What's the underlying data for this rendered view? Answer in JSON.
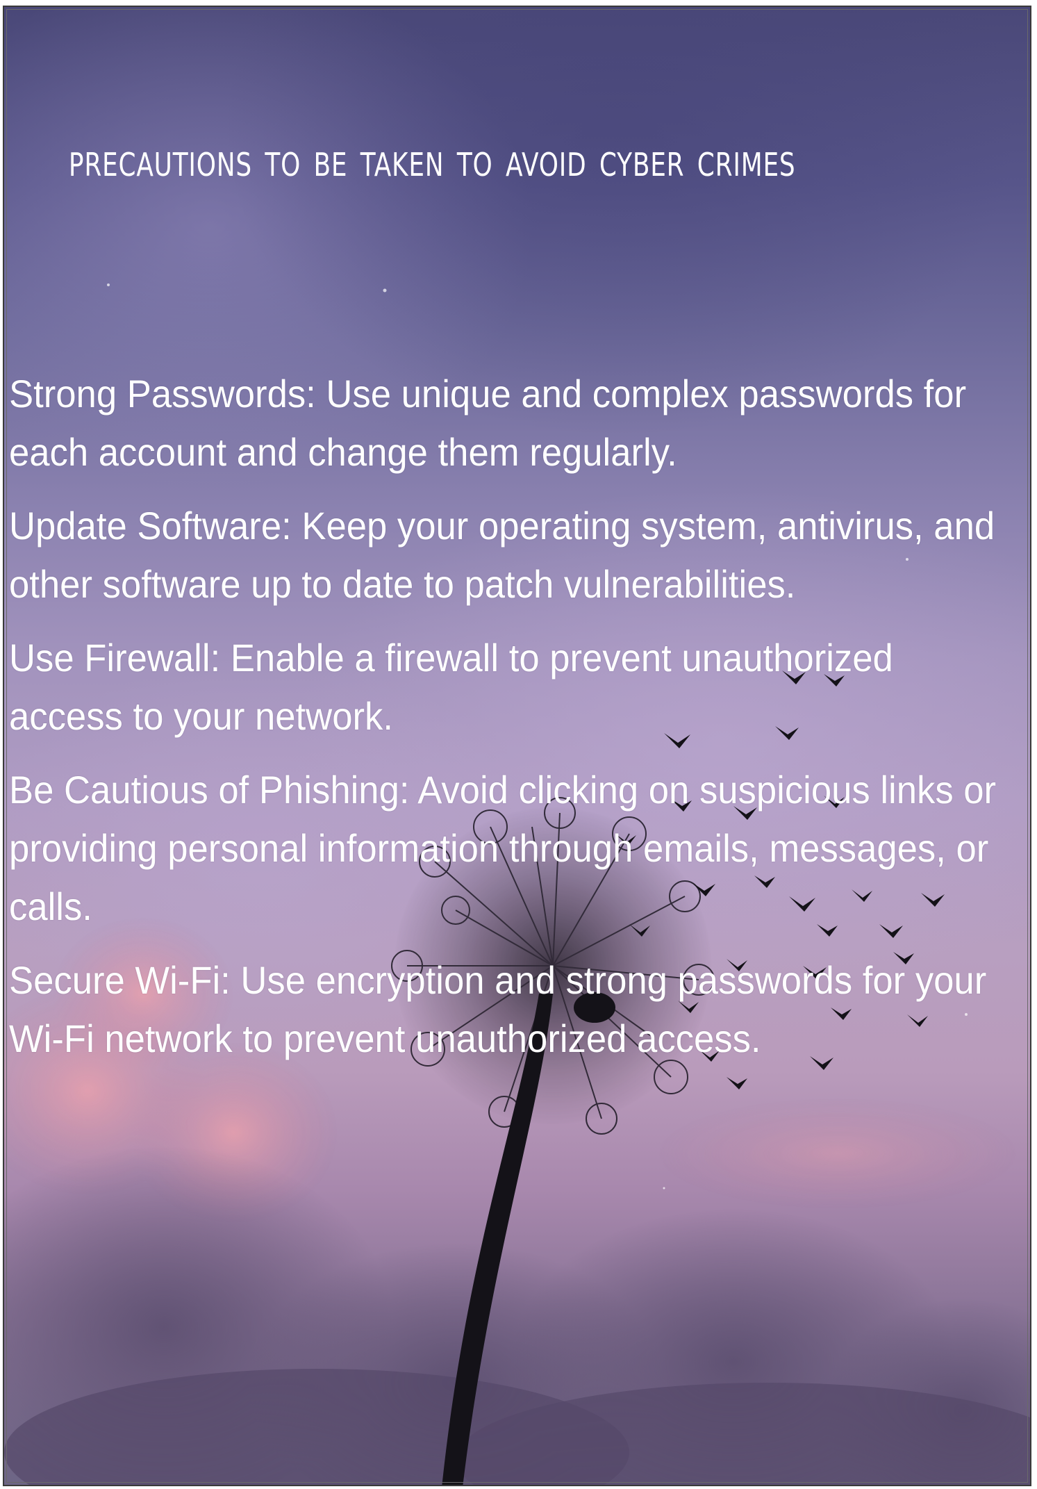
{
  "title": "PRECAUTIONS TO BE TAKEN TO AVOID CYBER CRIMES",
  "precautions": [
    "Strong Passwords: Use unique and complex passwords for each account and change them regularly.",
    "Update Software: Keep your operating system, antivirus, and other software up to date to patch vulnerabilities.",
    "Use Firewall: Enable a firewall to prevent unauthorized access to your network.",
    "Be Cautious of Phishing: Avoid clicking on suspicious links or providing personal information through emails, messages, or calls.",
    "Secure Wi-Fi: Use encryption and strong passwords for your Wi-Fi network to prevent unauthorized access."
  ],
  "colors": {
    "text": "#ffffff",
    "sky_top": "#4a4878",
    "sky_mid": "#a293bd",
    "sky_low": "#b99bbb",
    "cloud_pink": "#e49aa8",
    "silhouette": "#141218"
  },
  "background_image": "dandelion-and-birds-silhouette-against-purple-sky"
}
